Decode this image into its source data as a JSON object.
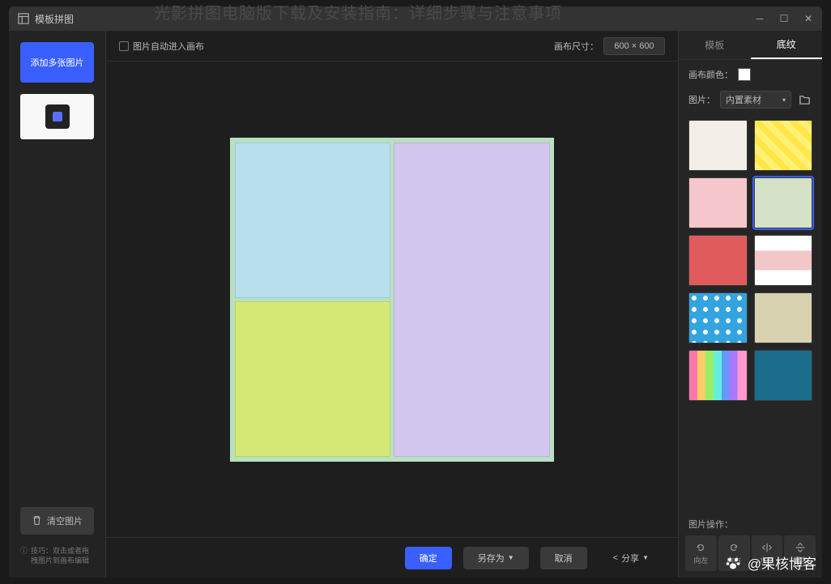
{
  "page_banner": "光影拼图电脑版下载及安装指南：详细步骤与注意事项",
  "titlebar": {
    "title": "模板拼图"
  },
  "left": {
    "add_label": "添加多张图片",
    "clear_label": "清空图片",
    "tip_prefix": "技巧：",
    "tip_text": "双击或者拖拽图片到画布编辑"
  },
  "top": {
    "checkbox_label": "图片自动进入画布",
    "size_label": "画布尺寸：",
    "size_value": "600 × 600"
  },
  "bottom": {
    "confirm": "确定",
    "save_as": "另存为",
    "cancel": "取消",
    "share": "分享"
  },
  "right": {
    "tabs": {
      "templates": "模板",
      "textures": "底纹"
    },
    "canvas_color_label": "画布颜色：",
    "image_label": "图片：",
    "source_select": "内置素材",
    "ops_label": "图片操作：",
    "ops": {
      "left": "向左",
      "right": "向右",
      "horiz": "水平",
      "vert": "垂直"
    },
    "textures": [
      {
        "name": "white-fabric",
        "bg": "#f3eee8"
      },
      {
        "name": "yellow-stripes",
        "bg": "repeating-linear-gradient(45deg,#fff176 0 8px,#ffe74a 8px 16px)"
      },
      {
        "name": "pink-dots",
        "bg": "#f5c7cc"
      },
      {
        "name": "green-border",
        "bg": "#d5e2c8",
        "selected": true
      },
      {
        "name": "red-fabric",
        "bg": "#e05c5c"
      },
      {
        "name": "white-stripe",
        "bg": "linear-gradient(#fff 30%,#f2c7c7 30% 70%,#fff 70%)"
      },
      {
        "name": "blue-polka",
        "bg": "radial-gradient(circle at 6px 6px,#fff 3px,transparent 3px) 0 0/14px 14px,#34a4e0"
      },
      {
        "name": "linen",
        "bg": "#d8d2b0"
      },
      {
        "name": "rainbow-stripes",
        "bg": "linear-gradient(90deg,#f7a 0 14%,#fc6 14% 28%,#9e6 28% 42%,#6ed 42% 56%,#69f 56% 70%,#a7f 70% 84%,#f9c 84%)"
      },
      {
        "name": "blue-paisley",
        "bg": "#1a6d8d"
      }
    ]
  },
  "watermark": "@果核博客"
}
